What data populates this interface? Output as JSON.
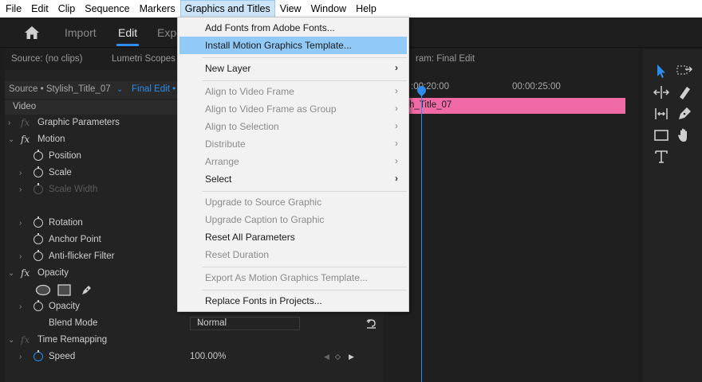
{
  "menubar": [
    "File",
    "Edit",
    "Clip",
    "Sequence",
    "Markers",
    "Graphics and Titles",
    "View",
    "Window",
    "Help"
  ],
  "workspace": {
    "tabs": [
      "Import",
      "Edit",
      "Expo"
    ]
  },
  "panels": {
    "source_tab": "Source: (no clips)",
    "lumetri_tab": "Lumetri Scopes",
    "program_tab": "ram: Final Edit",
    "source_clip": "Source • Stylish_Title_07",
    "sequence": "Final Edit • "
  },
  "effects": {
    "video_header": "Video",
    "graphic_parameters": "Graphic Parameters",
    "motion": "Motion",
    "position": "Position",
    "scale": "Scale",
    "scale_width": "Scale Width",
    "rotation": "Rotation",
    "anchor_point": "Anchor Point",
    "anti_flicker": "Anti-flicker Filter",
    "opacity_section": "Opacity",
    "opacity": "Opacity",
    "blend_mode": "Blend Mode",
    "blend_mode_value": "Normal",
    "time_remapping": "Time Remapping",
    "speed": "Speed",
    "speed_value": "100.00%"
  },
  "timeline": {
    "timecode_1": ":00:20:00",
    "timecode_2": "00:00:25:00",
    "clip_label": "h_Title_07"
  },
  "dropdown": {
    "items": [
      "Add Fonts from Adobe Fonts...",
      "Install Motion Graphics Template...",
      "New Layer",
      "Align to Video Frame",
      "Align to Video Frame as Group",
      "Align to Selection",
      "Distribute",
      "Arrange",
      "Select",
      "Upgrade to Source Graphic",
      "Upgrade Caption to Graphic",
      "Reset All Parameters",
      "Reset Duration",
      "Export As Motion Graphics Template...",
      "Replace Fonts in Projects..."
    ]
  },
  "colors": {
    "accent": "#2d8ceb",
    "clip": "#f06aa5",
    "menu_highlight": "#91c9f7"
  }
}
